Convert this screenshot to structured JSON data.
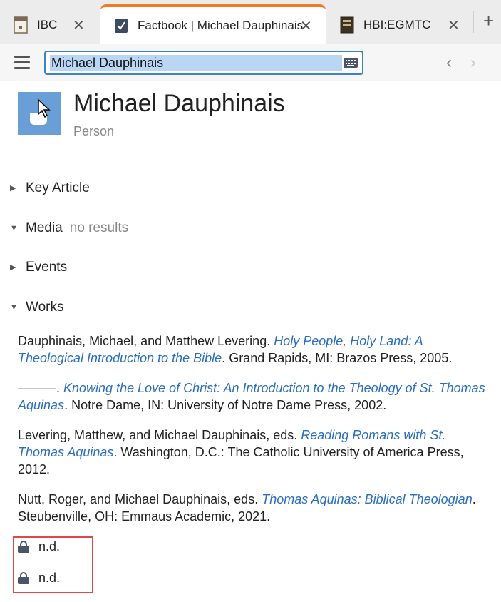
{
  "tabs": [
    {
      "label": "IBC",
      "icon": "book-icon",
      "active": false
    },
    {
      "label": "Factbook | Michael Dauphinais",
      "icon": "factbook-icon",
      "active": true
    },
    {
      "label": "HBI:EGMTC",
      "icon": "book-icon",
      "active": false
    }
  ],
  "tab_close_glyph": "✕",
  "tab_add_glyph": "+",
  "search": {
    "value": "Michael Dauphinais"
  },
  "nav": {
    "back_glyph": "‹",
    "forward_glyph": "›"
  },
  "header": {
    "title": "Michael Dauphinais",
    "subtitle": "Person"
  },
  "sections": {
    "key_article": {
      "label": "Key Article",
      "expanded": false
    },
    "media": {
      "label": "Media",
      "note": "no results",
      "expanded": true
    },
    "events": {
      "label": "Events",
      "expanded": false
    },
    "works": {
      "label": "Works",
      "expanded": true
    }
  },
  "works": [
    {
      "prefix": "Dauphinais, Michael, and Matthew Levering. ",
      "title": "Holy People, Holy Land: A Theological Introduction to the Bible",
      "suffix": ". Grand Rapids, MI: Brazos Press, 2005."
    },
    {
      "prefix": "———. ",
      "title": "Knowing the Love of Christ: An Introduction to the Theology of St. Thomas Aquinas",
      "suffix": ". Notre Dame, IN: University of Notre Dame Press, 2002."
    },
    {
      "prefix": "Levering, Matthew, and Michael Dauphinais, eds. ",
      "title": "Reading Romans with St. Thomas Aquinas",
      "suffix": ". Washington, D.C.: The Catholic University of America Press, 2012."
    },
    {
      "prefix": "Nutt, Roger, and Michael Dauphinais, eds. ",
      "title": "Thomas Aquinas: Biblical Theologian",
      "suffix": ". Steubenville, OH: Emmaus Academic, 2021."
    }
  ],
  "locked_items": [
    {
      "label": "n.d.",
      "icon": "lock-icon"
    },
    {
      "label": "n.d.",
      "icon": "lock-icon"
    }
  ],
  "colors": {
    "accent": "#f07a24",
    "link": "#2a6fbf",
    "highlight": "#e04848",
    "avatar": "#6a9ed6"
  }
}
